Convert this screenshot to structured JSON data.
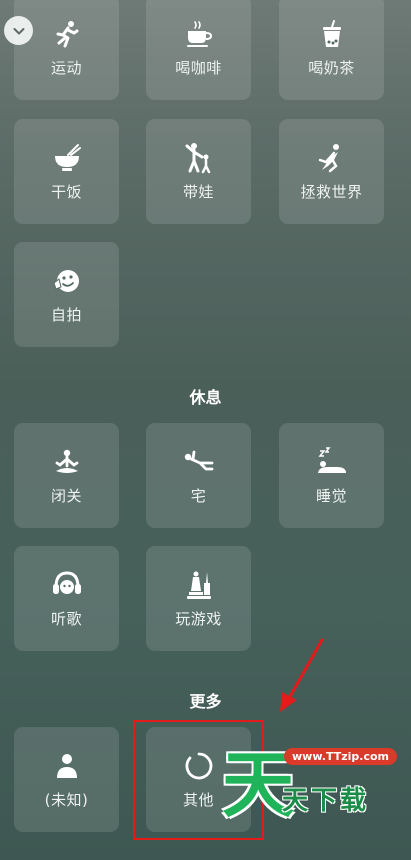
{
  "top_items": [
    {
      "label": "运动",
      "icon": "running-icon"
    },
    {
      "label": "喝咖啡",
      "icon": "coffee-cup-icon"
    },
    {
      "label": "喝奶茶",
      "icon": "bubble-tea-icon"
    },
    {
      "label": "干饭",
      "icon": "rice-bowl-icon"
    },
    {
      "label": "带娃",
      "icon": "parent-child-icon"
    },
    {
      "label": "拯救世界",
      "icon": "superhero-icon"
    },
    {
      "label": "自拍",
      "icon": "selfie-icon"
    }
  ],
  "rest_section": {
    "title": "休息",
    "items": [
      {
        "label": "闭关",
        "icon": "meditation-icon"
      },
      {
        "label": "宅",
        "icon": "lying-down-icon"
      },
      {
        "label": "睡觉",
        "icon": "sleeping-icon"
      },
      {
        "label": "听歌",
        "icon": "headphones-icon"
      },
      {
        "label": "玩游戏",
        "icon": "chess-pieces-icon"
      }
    ]
  },
  "more_section": {
    "title": "更多",
    "items": [
      {
        "label": "(未知)",
        "icon": "person-icon"
      },
      {
        "label": "其他",
        "icon": "circle-loading-icon"
      }
    ]
  },
  "watermark": {
    "big_char": "天",
    "url": "www.TTzip.com",
    "text": "天下载"
  },
  "colors": {
    "tile_bg": "rgba(255,255,255,0.12)",
    "highlight": "#e21b1b",
    "watermark_green": "#1fb45a"
  }
}
